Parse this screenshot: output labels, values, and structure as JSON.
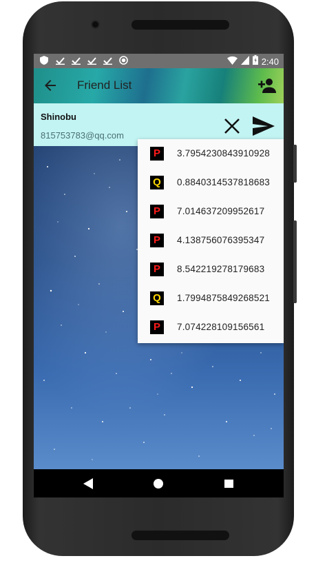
{
  "status_bar": {
    "time": "2:40",
    "left_icons": [
      "shield-icon",
      "download-icon",
      "download-icon",
      "download-icon",
      "download-icon",
      "record-icon"
    ],
    "right_icons": [
      "wifi-icon",
      "signal-icon",
      "battery-charging-icon"
    ]
  },
  "app_bar": {
    "title": "Friend List",
    "back_icon": "arrow-back-icon",
    "add_icon": "person-add-icon"
  },
  "friend": {
    "name": "Shinobu",
    "email": "815753783@qq.com"
  },
  "actions": {
    "close_icon": "close-icon",
    "send_icon": "send-icon"
  },
  "dropdown_items": [
    {
      "badge": "P",
      "value": "3.7954230843910928"
    },
    {
      "badge": "Q",
      "value": "0.8840314537818683"
    },
    {
      "badge": "P",
      "value": "7.014637209952617"
    },
    {
      "badge": "P",
      "value": "4.138756076395347"
    },
    {
      "badge": "P",
      "value": "8.542219278179683"
    },
    {
      "badge": "Q",
      "value": "1.7994875849268521"
    },
    {
      "badge": "P",
      "value": "7.074228109156561"
    }
  ],
  "colors": {
    "friend_bar": "#c2f4f3",
    "badge_p": "#ff1a1a",
    "badge_q": "#ffd700"
  },
  "nav_bar": {
    "back_icon": "nav-back-icon",
    "home_icon": "nav-home-icon",
    "recents_icon": "nav-recents-icon"
  }
}
